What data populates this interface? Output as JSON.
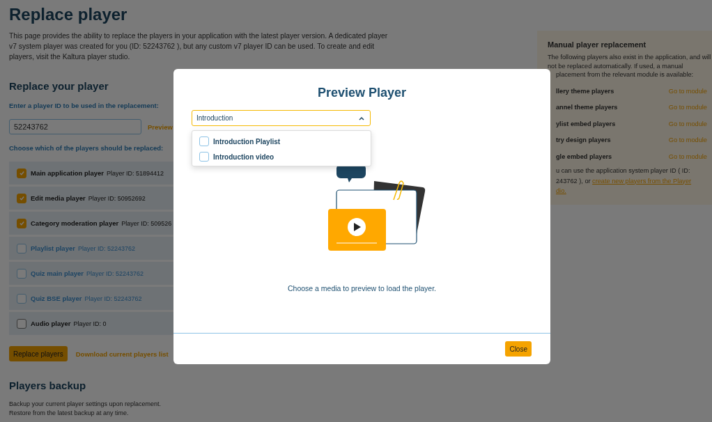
{
  "page": {
    "title": "Replace player",
    "intro": "This page provides the ability to replace the players in your application with the latest player version. A dedicated player v7 system player was created for you (ID: 52243762 ), but any custom v7 player ID can be used. To create and edit players, visit the Kaltura player studio."
  },
  "replace_section": {
    "heading": "Replace your player",
    "id_label": "Enter a player ID to be used in the replacement:",
    "player_id_field": {
      "value": "52243762"
    },
    "preview_link": "Preview",
    "choose_label": "Choose which of the players should be replaced:",
    "players": [
      {
        "name": "Main application player",
        "player_id": "Player ID: 51894412",
        "checked": true,
        "disabled": false
      },
      {
        "name": "Edit media player",
        "player_id": "Player ID: 50952692",
        "checked": true,
        "disabled": false
      },
      {
        "name": "Category moderation player",
        "player_id": "Player ID: 509526",
        "checked": true,
        "disabled": false
      },
      {
        "name": "Playlist player",
        "player_id": "Player ID: 52243762",
        "checked": false,
        "disabled": true
      },
      {
        "name": "Quiz main player",
        "player_id": "Player ID: 52243762",
        "checked": false,
        "disabled": true
      },
      {
        "name": "Quiz BSE player",
        "player_id": "Player ID: 52243762",
        "checked": false,
        "disabled": true
      },
      {
        "name": "Audio player",
        "player_id": "Player ID: 0",
        "checked": false,
        "disabled": false
      }
    ],
    "replace_button": "Replace players",
    "download_link": "Download current players list"
  },
  "backup": {
    "heading": "Players backup",
    "text": "Backup your current player settings upon replacement. Restore from the latest backup at any time."
  },
  "manual_panel": {
    "title": "Manual player replacement",
    "intro": "The following players also exist in the application, and will not be replaced automatically. If used, a manual",
    "intro_continued": "placement from the relevant module is available:",
    "modules": [
      {
        "name": "llery theme players",
        "link": "Go to module"
      },
      {
        "name": "annel theme players",
        "link": "Go to module"
      },
      {
        "name": "ylist embed players",
        "link": "Go to module"
      },
      {
        "name": "try design players",
        "link": "Go to module"
      },
      {
        "name": "gle embed players",
        "link": "Go to module"
      }
    ],
    "note_lines": [
      {
        "text": "u can use the application system player ID ( ID:"
      },
      {
        "text": "243762 ), or ",
        "link": "create new players from the Player"
      },
      {
        "link": "dio."
      }
    ]
  },
  "modal": {
    "title": "Preview Player",
    "select": {
      "value": "Introduction",
      "expanded": true
    },
    "options": [
      {
        "label": "Introduction Playlist",
        "checked": false
      },
      {
        "label": "Introduction video",
        "checked": false
      }
    ],
    "caption": "Choose a media to preview to load the player.",
    "close_button": "Close"
  }
}
